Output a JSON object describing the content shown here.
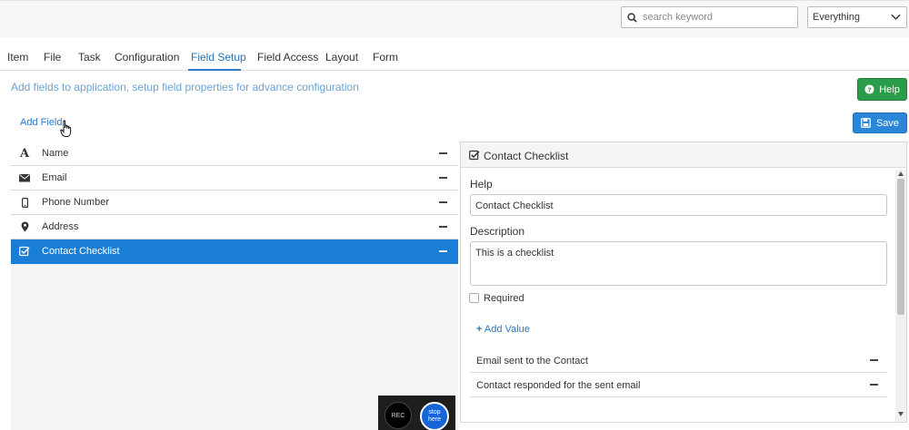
{
  "header": {
    "search": {
      "placeholder": "search keyword",
      "value": ""
    },
    "scope_select": {
      "value": "Everything"
    }
  },
  "tabs": [
    {
      "label": "Item"
    },
    {
      "label": "File"
    },
    {
      "label": "Task"
    },
    {
      "label": "Configuration"
    },
    {
      "label": "Field Setup",
      "active": true
    },
    {
      "label": "Field Access"
    },
    {
      "label": "Layout"
    },
    {
      "label": "Form"
    }
  ],
  "subtitle": "Add fields to application, setup field properties for advance configuration",
  "buttons": {
    "help": "Help",
    "save": "Save"
  },
  "add_field": "Add Field",
  "fields": [
    {
      "label": "Name",
      "icon": "font-icon"
    },
    {
      "label": "Email",
      "icon": "envelope-icon"
    },
    {
      "label": "Phone Number",
      "icon": "mobile-icon"
    },
    {
      "label": "Address",
      "icon": "map-marker-icon"
    },
    {
      "label": "Contact Checklist",
      "icon": "checkbox-icon",
      "selected": true
    }
  ],
  "panel": {
    "title": "Contact Checklist",
    "help_label": "Help",
    "help_value": "Contact Checklist",
    "description_label": "Description",
    "description_value": "This is a checklist",
    "required_label": "Required",
    "required_checked": false,
    "add_value": "Add Value",
    "values": [
      {
        "label": "Email sent to the Contact"
      },
      {
        "label": "Contact responded for the sent email"
      }
    ]
  },
  "recorder": {
    "rec": "REC",
    "stop": "stop here"
  },
  "colors": {
    "accent": "#2a7ac7",
    "selected_row": "#1b7ed6",
    "help_button": "#2a9d4a",
    "save_button": "#2a86d8"
  }
}
